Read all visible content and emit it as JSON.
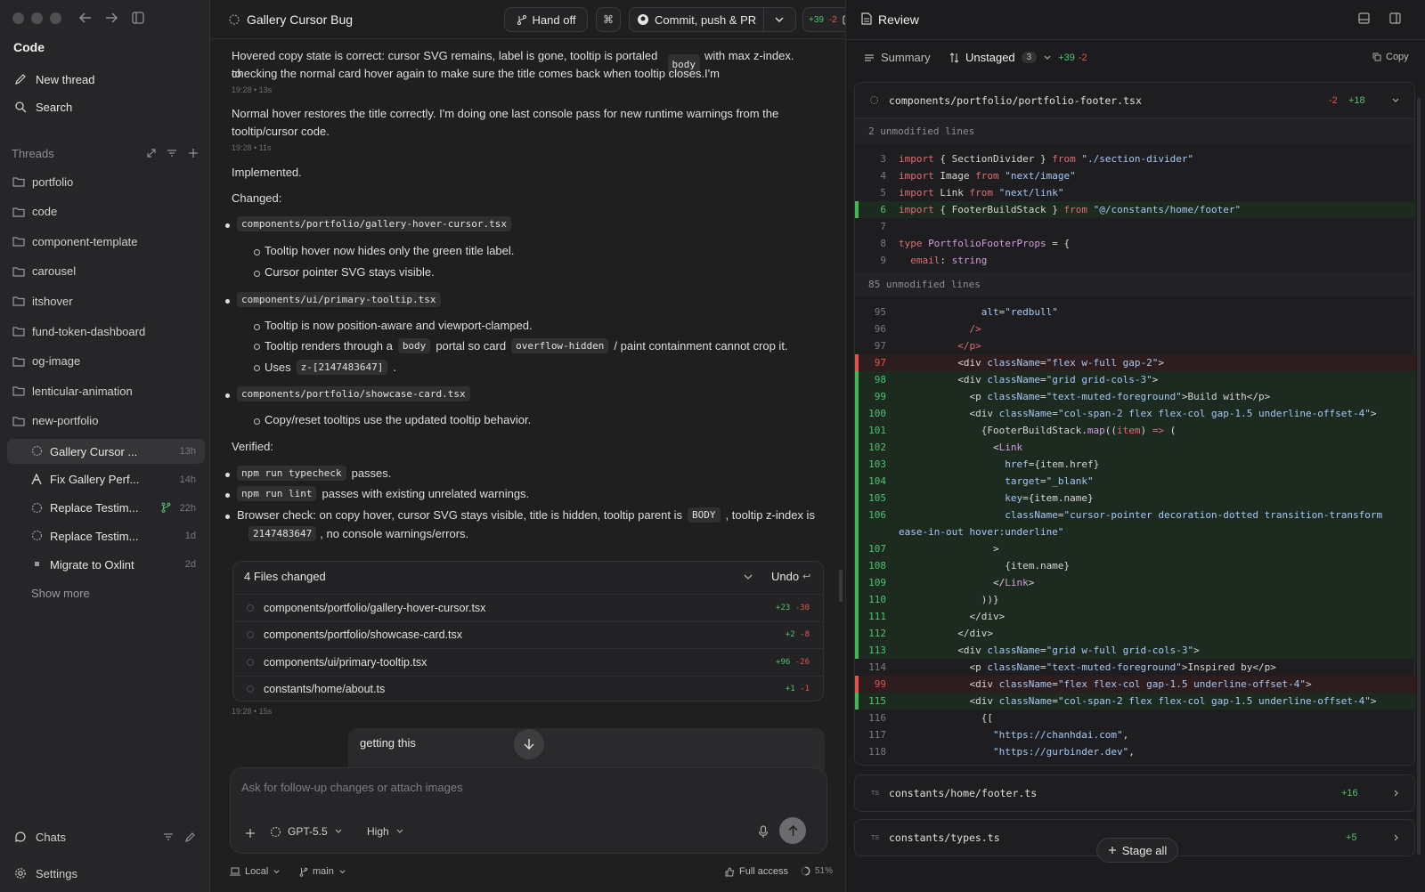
{
  "sidebar": {
    "title": "Code",
    "new_thread": "New thread",
    "search": "Search",
    "threads_header": "Threads",
    "folders": [
      "portfolio",
      "code",
      "component-template",
      "carousel",
      "itshover",
      "fund-token-dashboard",
      "og-image",
      "lenticular-animation",
      "new-portfolio"
    ],
    "threads": [
      {
        "name": "Gallery Cursor ...",
        "time": "13h",
        "icon": "spinner-icon"
      },
      {
        "name": "Fix Gallery Perf...",
        "time": "14h",
        "icon": "model-icon"
      },
      {
        "name": "Replace Testim...",
        "time": "22h",
        "icon": "spinner-icon"
      },
      {
        "name": "Replace Testim...",
        "time": "1d",
        "icon": "spinner-icon"
      },
      {
        "name": "Migrate to Oxlint",
        "time": "2d",
        "icon": "square-icon"
      }
    ],
    "show_more": "Show more",
    "chats": "Chats",
    "settings": "Settings"
  },
  "header": {
    "title": "Gallery Cursor Bug",
    "hand_off": "Hand off",
    "commit": "Commit, push & PR",
    "diff_add": "+39",
    "diff_del": "-2"
  },
  "chat": {
    "p1": "Hovered copy state is correct: cursor SVG remains, label is gone, tooltip is portaled to",
    "p1_code": "body",
    "p1_tail": "with max z-index. I'm",
    "p1_line2": "checking the normal card hover again to make sure the title comes back when tooltip closes.",
    "ts1": "19:28 • 13s",
    "p2_line1": "Normal hover restores the title correctly. I'm doing one last console pass for new runtime warnings from the",
    "p2_line2": "tooltip/cursor code.",
    "ts2": "19:28 • 11s",
    "implemented": "Implemented.",
    "changed": "Changed:",
    "file1": "components/portfolio/gallery-hover-cursor.tsx",
    "f1_s1": "Tooltip hover now hides only the green title label.",
    "f1_s2": "Cursor pointer SVG stays visible.",
    "file2": "components/ui/primary-tooltip.tsx",
    "f2_s1": "Tooltip is now position-aware and viewport-clamped.",
    "f2_s2_a": "Tooltip renders through a",
    "f2_s2_code1": "body",
    "f2_s2_b": "portal so card",
    "f2_s2_code2": "overflow-hidden",
    "f2_s2_c": "/ paint containment cannot crop it.",
    "f2_s3_a": "Uses",
    "f2_s3_code": "z-[2147483647]",
    "f2_s3_b": ".",
    "file3": "components/portfolio/showcase-card.tsx",
    "f3_s1": "Copy/reset tooltips use the updated tooltip behavior.",
    "verified": "Verified:",
    "v1_code": "npm run typecheck",
    "v1_text": "passes.",
    "v2_code": "npm run lint",
    "v2_text": "passes with existing unrelated warnings.",
    "v3_a": "Browser check: on copy hover, cursor SVG stays visible, title is hidden, tooltip parent is",
    "v3_code1": "BODY",
    "v3_b": ", tooltip z-index is",
    "v3_code2": "2147483647",
    "v3_c": ", no console warnings/errors."
  },
  "files_changed": {
    "title": "4 Files changed",
    "undo": "Undo",
    "files": [
      {
        "name": "components/portfolio/gallery-hover-cursor.tsx",
        "add": "+23",
        "del": "-30"
      },
      {
        "name": "components/portfolio/showcase-card.tsx",
        "add": "+2",
        "del": "-8"
      },
      {
        "name": "components/ui/primary-tooltip.tsx",
        "add": "+96",
        "del": "-26"
      },
      {
        "name": "constants/home/about.ts",
        "add": "+1",
        "del": "-1"
      }
    ],
    "ts": "19:28 • 15s"
  },
  "popup_text": "getting this",
  "composer": {
    "placeholder": "Ask for follow-up changes or attach images",
    "model": "GPT-5.5",
    "effort": "High"
  },
  "footer": {
    "local": "Local",
    "branch": "main",
    "access": "Full access",
    "context": "51%"
  },
  "review": {
    "title": "Review",
    "summary_tab": "Summary",
    "unstaged_tab": "Unstaged",
    "unstaged_count": "3",
    "add": "+39",
    "del": "-2",
    "copy": "Copy",
    "file1": {
      "name": "components/portfolio/portfolio-footer.tsx",
      "del": "-2",
      "add": "+18"
    },
    "unmod1": "2 unmodified lines",
    "unmod2": "85 unmodified lines",
    "file2": {
      "name": "constants/home/footer.ts",
      "add": "+16"
    },
    "file3": {
      "name": "constants/types.ts",
      "add": "+5"
    },
    "stage_all": "Stage all"
  },
  "colors": {
    "add": "#4cc36b",
    "del": "#e5534b",
    "bg": "#1c1c1e"
  }
}
